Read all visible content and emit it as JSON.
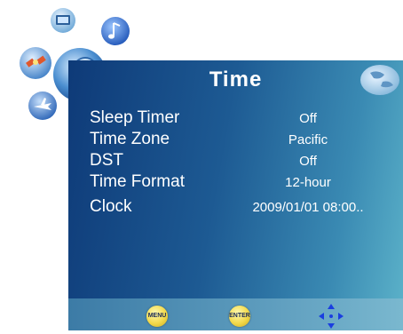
{
  "screen": {
    "title": "Time"
  },
  "settings": [
    {
      "label": "Sleep Timer",
      "value": "Off"
    },
    {
      "label": "Time Zone",
      "value": "Pacific"
    },
    {
      "label": "DST",
      "value": "Off"
    },
    {
      "label": "Time Format",
      "value": "12-hour"
    },
    {
      "label": "Clock",
      "value": "2009/01/01 08:00.."
    }
  ],
  "footer": {
    "menu_label": "MENU",
    "enter_label": "ENTER"
  },
  "colors": {
    "panel_dark": "#0e3a78",
    "panel_light": "#5ab0c8",
    "button_yellow": "#f2d94a",
    "arrow_blue": "#1a3ee0"
  }
}
